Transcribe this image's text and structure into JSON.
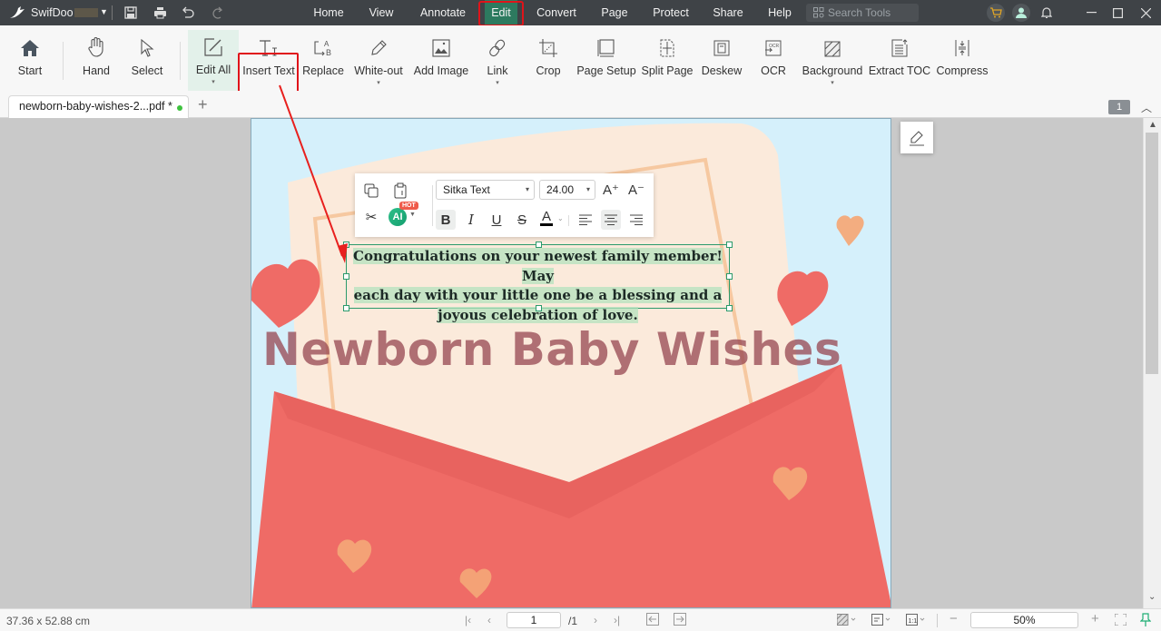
{
  "titlebar": {
    "app_name": "SwifDoo",
    "menus": [
      "Home",
      "View",
      "Annotate",
      "Edit",
      "Convert",
      "Page",
      "Protect",
      "Share",
      "Help"
    ],
    "active_menu": "Edit",
    "search_placeholder": "Search Tools"
  },
  "ribbon": {
    "items": [
      {
        "label": "Start",
        "icon": "home-icon"
      },
      {
        "label": "Hand",
        "icon": "hand-icon"
      },
      {
        "label": "Select",
        "icon": "cursor-icon"
      },
      {
        "label": "Edit All",
        "icon": "edit-box-icon",
        "dropdown": true
      },
      {
        "label": "Insert Text",
        "icon": "insert-text-icon"
      },
      {
        "label": "Replace",
        "icon": "replace-icon"
      },
      {
        "label": "White-out",
        "icon": "eraser-pen-icon",
        "dropdown": true
      },
      {
        "label": "Add Image",
        "icon": "image-icon"
      },
      {
        "label": "Link",
        "icon": "link-icon",
        "dropdown": true
      },
      {
        "label": "Crop",
        "icon": "crop-icon"
      },
      {
        "label": "Page Setup",
        "icon": "page-setup-icon"
      },
      {
        "label": "Split Page",
        "icon": "split-page-icon"
      },
      {
        "label": "Deskew",
        "icon": "deskew-icon"
      },
      {
        "label": "OCR",
        "icon": "ocr-icon"
      },
      {
        "label": "Background",
        "icon": "background-icon",
        "dropdown": true
      },
      {
        "label": "Extract TOC",
        "icon": "extract-toc-icon"
      },
      {
        "label": "Compress",
        "icon": "compress-icon"
      }
    ],
    "caret": "▾"
  },
  "tabs": {
    "doc_tab_label": "newborn-baby-wishes-2...pdf *",
    "add_symbol": "+",
    "page_badge": "1"
  },
  "format_toolbar": {
    "font": "Sitka Text",
    "size": "24.00",
    "ai_label": "AI",
    "hot_label": "HOT",
    "bold": "B",
    "italic": "I",
    "underline": "U",
    "strike": "S",
    "font_color_letter": "A",
    "font_color": "#000000",
    "grow": "A⁺",
    "shrink": "A⁻"
  },
  "document": {
    "text_lines": [
      "Congratulations on your newest family member! May",
      "each day with your little one be a blessing and a",
      "joyous celebration of love."
    ],
    "banner_title": "Newborn Baby Wishes"
  },
  "statusbar": {
    "dimensions": "37.36 x 52.88 cm",
    "current_page": "1",
    "total_pages": "/1",
    "zoom": "50%"
  },
  "colors": {
    "accent": "#2d7a5f",
    "highlight_annotation": "#e0141a",
    "selection_border": "#2b9a6b"
  }
}
